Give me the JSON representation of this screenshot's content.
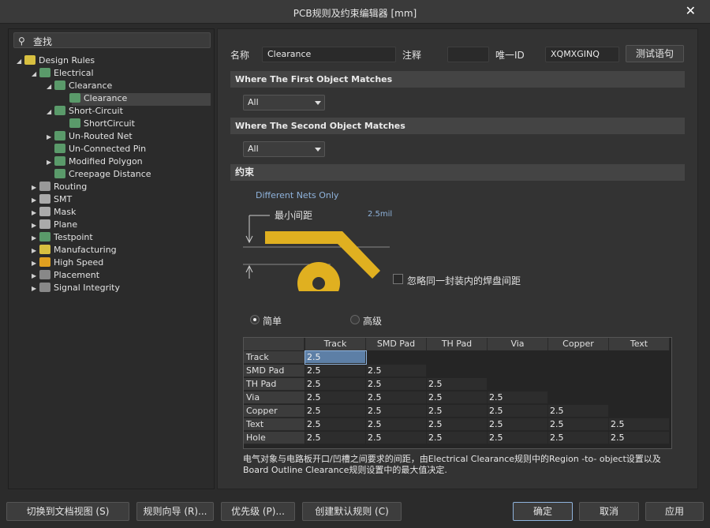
{
  "window": {
    "title": "PCB规则及约束编辑器 [mm]"
  },
  "search": {
    "placeholder": "查找"
  },
  "tree": [
    {
      "label": "Design Rules",
      "expanded": true
    },
    {
      "label": "Electrical",
      "expanded": true
    },
    {
      "label": "Clearance",
      "expanded": true
    },
    {
      "label": "Clearance",
      "selected": true
    },
    {
      "label": "Short-Circuit",
      "expanded": true
    },
    {
      "label": "ShortCircuit"
    },
    {
      "label": "Un-Routed Net",
      "expanded": false
    },
    {
      "label": "Un-Connected Pin"
    },
    {
      "label": "Modified Polygon",
      "expanded": false
    },
    {
      "label": "Creepage Distance"
    },
    {
      "label": "Routing",
      "expanded": false
    },
    {
      "label": "SMT",
      "expanded": false
    },
    {
      "label": "Mask",
      "expanded": false
    },
    {
      "label": "Plane",
      "expanded": false
    },
    {
      "label": "Testpoint",
      "expanded": false
    },
    {
      "label": "Manufacturing",
      "expanded": false
    },
    {
      "label": "High Speed",
      "expanded": false
    },
    {
      "label": "Placement",
      "expanded": false
    },
    {
      "label": "Signal Integrity",
      "expanded": false
    }
  ],
  "rule": {
    "name_label": "名称",
    "name_value": "Clearance",
    "comment_label": "注释",
    "comment_value": "",
    "uid_label": "唯一ID",
    "uid_value": "XQMXGINQ",
    "test_button": "测试语句"
  },
  "first_match": {
    "header": "Where The First Object Matches",
    "value": "All"
  },
  "second_match": {
    "header": "Where The Second Object Matches",
    "value": "All"
  },
  "constraints": {
    "header": "约束",
    "net_scope": "Different Nets Only",
    "min_clearance_label": "最小间距",
    "min_clearance_value": "2.5mil",
    "ignore_pads_label": "忽略同一封装内的焊盘间距",
    "ignore_pads_checked": false,
    "mode_simple": "简单",
    "mode_advanced": "高级",
    "mode_selected": "simple"
  },
  "matrix": {
    "columns": [
      "Track",
      "SMD Pad",
      "TH Pad",
      "Via",
      "Copper",
      "Text"
    ],
    "rows": [
      {
        "label": "Track",
        "values": [
          "2.5"
        ]
      },
      {
        "label": "SMD Pad",
        "values": [
          "2.5",
          "2.5"
        ]
      },
      {
        "label": "TH Pad",
        "values": [
          "2.5",
          "2.5",
          "2.5"
        ]
      },
      {
        "label": "Via",
        "values": [
          "2.5",
          "2.5",
          "2.5",
          "2.5"
        ]
      },
      {
        "label": "Copper",
        "values": [
          "2.5",
          "2.5",
          "2.5",
          "2.5",
          "2.5"
        ]
      },
      {
        "label": "Text",
        "values": [
          "2.5",
          "2.5",
          "2.5",
          "2.5",
          "2.5",
          "2.5"
        ]
      },
      {
        "label": "Hole",
        "values": [
          "2.5",
          "2.5",
          "2.5",
          "2.5",
          "2.5",
          "2.5"
        ]
      }
    ]
  },
  "description": "电气对象与电路板开口/凹槽之间要求的间距，由Electrical Clearance规则中的Region -to- object设置以及Board Outline Clearance规则设置中的最大值决定.",
  "buttons": {
    "doc_view": "切换到文档视图 (S)",
    "wizard": "规则向导 (R)...",
    "priority": "优先级 (P)...",
    "default_rules": "创建默认规则 (C)",
    "ok": "确定",
    "cancel": "取消",
    "apply": "应用"
  },
  "colors": {
    "copper": "#e0b020",
    "accent": "#8fb3dc"
  }
}
